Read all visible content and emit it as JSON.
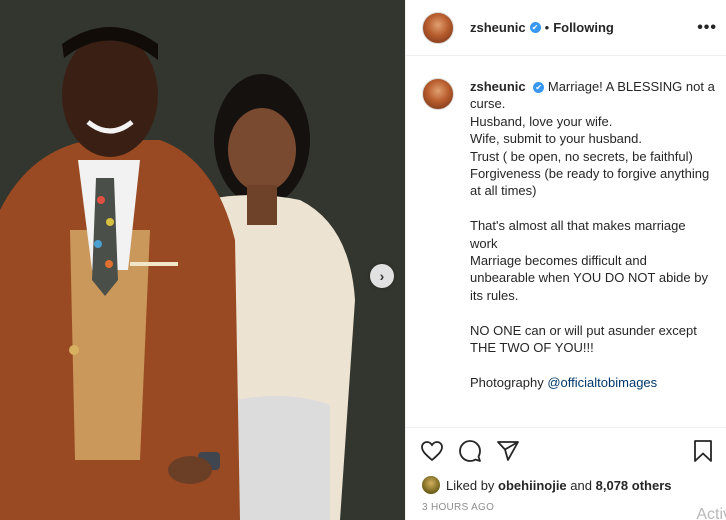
{
  "post": {
    "username": "zsheunic",
    "verified_glyph": "✔",
    "separator": "•",
    "follow_status": "Following",
    "more_glyph": "•••",
    "next_glyph": "›"
  },
  "caption": {
    "username": "zsheunic",
    "lines": [
      "Marriage! A BLESSING not a curse.",
      "Husband, love your wife.",
      "Wife, submit to your husband.",
      "Trust ( be open, no secrets, be faithful)",
      "Forgiveness (be ready to forgive anything at all times)",
      "",
      "That's almost all that makes marriage work",
      "Marriage becomes difficult and unbearable when YOU DO NOT abide by its rules.",
      "",
      "NO ONE can or will put asunder except THE TWO OF YOU!!!",
      ""
    ],
    "photo_credit_label": "Photography",
    "photo_credit_mention": "@officialtobimages"
  },
  "actions": {
    "icons": [
      "heart-icon",
      "comment-icon",
      "share-icon",
      "bookmark-icon"
    ]
  },
  "likes": {
    "prefix": "Liked by",
    "user": "obehiinojie",
    "joiner": "and",
    "count": "8,078 others"
  },
  "timestamp": "3 HOURS AGO",
  "watermark": "Activ",
  "colors": {
    "verified": "#3897f0",
    "mention": "#00376b",
    "muted": "#8e8e8e"
  }
}
